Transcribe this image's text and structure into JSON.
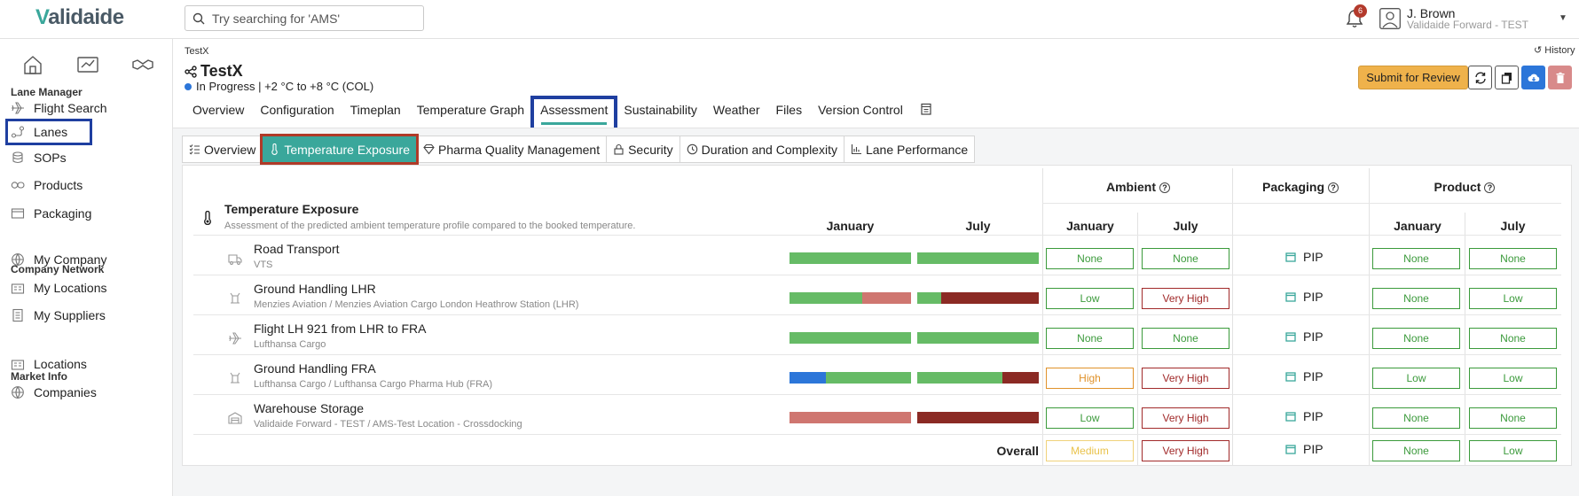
{
  "app": {
    "logo_text": "alidaide",
    "logo_mark": "V"
  },
  "search": {
    "placeholder": "Try searching for 'AMS'"
  },
  "notifications": {
    "count": "6"
  },
  "user": {
    "name": "J. Brown",
    "org": "Validaide Forward - TEST"
  },
  "sidebar": {
    "sections": {
      "lane_manager": "Lane Manager",
      "company_network": "Company Network",
      "market_info": "Market Info"
    },
    "items": [
      {
        "label": "Flight Search",
        "icon": "plane-icon"
      },
      {
        "label": "Lanes",
        "icon": "route-icon"
      },
      {
        "label": "SOPs",
        "icon": "coins-icon"
      },
      {
        "label": "Products",
        "icon": "pills-icon"
      },
      {
        "label": "Packaging",
        "icon": "box-icon"
      },
      {
        "label": "My Company",
        "icon": "globe-icon"
      },
      {
        "label": "My Locations",
        "icon": "building-icon"
      },
      {
        "label": "My Suppliers",
        "icon": "document-icon"
      },
      {
        "label": "Locations",
        "icon": "building-icon"
      },
      {
        "label": "Companies",
        "icon": "globe-icon"
      }
    ]
  },
  "lane": {
    "breadcrumb": "TestX",
    "title": "TestX",
    "status": "In Progress | +2 °C to +8 °C (COL)",
    "history_label": "History",
    "submit_label": "Submit for Review"
  },
  "tabs": [
    "Overview",
    "Configuration",
    "Timeplan",
    "Temperature Graph",
    "Assessment",
    "Sustainability",
    "Weather",
    "Files",
    "Version Control"
  ],
  "subtabs": [
    "Overview",
    "Temperature Exposure",
    "Pharma Quality Management",
    "Security",
    "Duration and Complexity",
    "Lane Performance"
  ],
  "exposure": {
    "title": "Temperature Exposure",
    "description": "Assessment of the predicted ambient temperature profile compared to the booked temperature.",
    "group_headers": {
      "ambient": "Ambient",
      "packaging": "Packaging",
      "product": "Product"
    },
    "col_headers": {
      "jan": "January",
      "jul": "July",
      "amb_jan": "January",
      "amb_jul": "July",
      "prod_jan": "January",
      "prod_jul": "July"
    },
    "colors": {
      "green": "#66bb66",
      "red": "#cf7670",
      "darkred": "#8b2a24",
      "blue": "#2c76d9"
    },
    "rows": [
      {
        "name": "Road Transport",
        "sub": "VTS",
        "icon": "truck-icon",
        "jan_bar": [
          {
            "c": "green",
            "f": 1
          }
        ],
        "jul_bar": [
          {
            "c": "green",
            "f": 1
          }
        ],
        "amb_jan": "None",
        "amb_jul": "None",
        "packaging": "PIP",
        "prod_jan": "None",
        "prod_jul": "None",
        "amb_jan_lvl": "g",
        "amb_jul_lvl": "g",
        "prod_jan_lvl": "g",
        "prod_jul_lvl": "g"
      },
      {
        "name": "Ground Handling LHR",
        "sub": "Menzies Aviation / Menzies Aviation Cargo London Heathrow Station (LHR)",
        "icon": "cart-icon",
        "jan_bar": [
          {
            "c": "green",
            "f": 0.6
          },
          {
            "c": "red",
            "f": 0.4
          }
        ],
        "jul_bar": [
          {
            "c": "green",
            "f": 0.2
          },
          {
            "c": "darkred",
            "f": 0.8
          }
        ],
        "amb_jan": "Low",
        "amb_jul": "Very High",
        "packaging": "PIP",
        "prod_jan": "None",
        "prod_jul": "Low",
        "amb_jan_lvl": "g",
        "amb_jul_lvl": "r",
        "prod_jan_lvl": "g",
        "prod_jul_lvl": "g"
      },
      {
        "name": "Flight LH 921 from LHR to FRA",
        "sub": "Lufthansa Cargo",
        "icon": "plane-icon",
        "jan_bar": [
          {
            "c": "green",
            "f": 1
          }
        ],
        "jul_bar": [
          {
            "c": "green",
            "f": 1
          }
        ],
        "amb_jan": "None",
        "amb_jul": "None",
        "packaging": "PIP",
        "prod_jan": "None",
        "prod_jul": "None",
        "amb_jan_lvl": "g",
        "amb_jul_lvl": "g",
        "prod_jan_lvl": "g",
        "prod_jul_lvl": "g"
      },
      {
        "name": "Ground Handling FRA",
        "sub": "Lufthansa Cargo / Lufthansa Cargo Pharma Hub (FRA)",
        "icon": "cart-icon",
        "jan_bar": [
          {
            "c": "blue",
            "f": 0.3
          },
          {
            "c": "green",
            "f": 0.7
          }
        ],
        "jul_bar": [
          {
            "c": "green",
            "f": 0.7
          },
          {
            "c": "darkred",
            "f": 0.3
          }
        ],
        "amb_jan": "High",
        "amb_jul": "Very High",
        "packaging": "PIP",
        "prod_jan": "Low",
        "prod_jul": "Low",
        "amb_jan_lvl": "o",
        "amb_jul_lvl": "r",
        "prod_jan_lvl": "g",
        "prod_jul_lvl": "g"
      },
      {
        "name": "Warehouse Storage",
        "sub": "Validaide Forward - TEST / AMS-Test Location - Crossdocking",
        "icon": "warehouse-icon",
        "jan_bar": [
          {
            "c": "red",
            "f": 1
          }
        ],
        "jul_bar": [
          {
            "c": "darkred",
            "f": 1
          }
        ],
        "amb_jan": "Low",
        "amb_jul": "Very High",
        "packaging": "PIP",
        "prod_jan": "None",
        "prod_jul": "None",
        "amb_jan_lvl": "g",
        "amb_jul_lvl": "r",
        "prod_jan_lvl": "g",
        "prod_jul_lvl": "g"
      }
    ],
    "overall": {
      "label": "Overall",
      "amb_jan": "Medium",
      "amb_jul": "Very High",
      "packaging": "PIP",
      "prod_jan": "None",
      "prod_jul": "Low",
      "amb_jan_lvl": "y",
      "amb_jul_lvl": "r",
      "prod_jan_lvl": "g",
      "prod_jul_lvl": "g"
    }
  }
}
